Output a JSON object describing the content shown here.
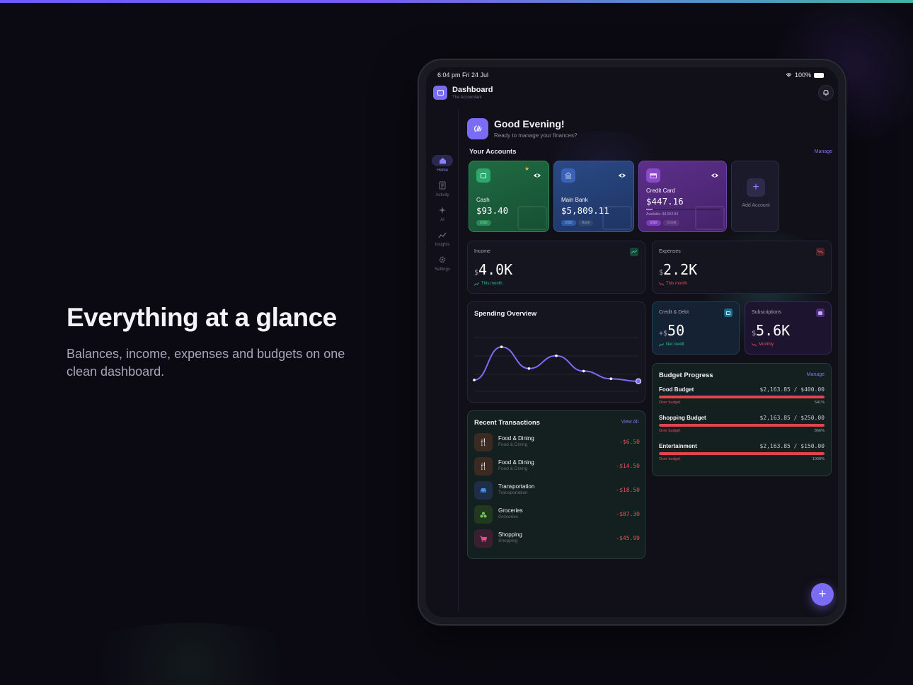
{
  "hero": {
    "title": "Everything at a glance",
    "subtitle": "Balances, income, expenses and budgets on one clean dashboard."
  },
  "status_bar": {
    "time": "6:04 pm  Fri 24 Jul",
    "battery": "100%"
  },
  "header": {
    "title": "Dashboard",
    "subtitle": "The Accountant"
  },
  "nav": [
    {
      "label": "Home",
      "icon": "home-icon",
      "active": true
    },
    {
      "label": "Activity",
      "icon": "activity-icon"
    },
    {
      "label": "AI",
      "icon": "sparkles-icon"
    },
    {
      "label": "Insights",
      "icon": "insights-icon"
    },
    {
      "label": "Settings",
      "icon": "gear-icon"
    }
  ],
  "greeting": {
    "title": "Good Evening!",
    "subtitle": "Ready to manage your finances?"
  },
  "accounts": {
    "title": "Your Accounts",
    "manage": "Manage",
    "items": [
      {
        "name": "Cash",
        "balance": "$93.40",
        "tags": [
          "USD"
        ]
      },
      {
        "name": "Main Bank",
        "balance": "$5,809.11",
        "tags": [
          "USD",
          "Bank"
        ]
      },
      {
        "name": "Credit Card",
        "balance": "$447.16",
        "available": "Available: $4,552.84",
        "tags": [
          "USD",
          "Credit"
        ]
      }
    ],
    "add_label": "Add Account"
  },
  "income": {
    "title": "Income",
    "prefix": "$",
    "value": "4.0K",
    "foot": "This month"
  },
  "expenses": {
    "title": "Expenses",
    "prefix": "$",
    "value": "2.2K",
    "foot": "This month"
  },
  "credit_debt": {
    "title": "Credit & Debt",
    "prefix": "+$",
    "value": "50",
    "foot": "Net credit"
  },
  "subscriptions": {
    "title": "Subscriptions",
    "prefix": "$",
    "value": "5.6K",
    "foot": "Monthly"
  },
  "spending": {
    "title": "Spending Overview",
    "points": [
      0.2,
      0.72,
      0.38,
      0.58,
      0.34,
      0.22,
      0.18
    ]
  },
  "budget": {
    "title": "Budget Progress",
    "manage": "Manage",
    "items": [
      {
        "name": "Food Budget",
        "value": "$2,163.85 / $400.00",
        "status": "Over budget",
        "percent": "541%",
        "fill": 1.0
      },
      {
        "name": "Shopping Budget",
        "value": "$2,163.85 / $250.00",
        "status": "Over budget",
        "percent": "866%",
        "fill": 1.0
      },
      {
        "name": "Entertainment",
        "value": "$2,163.85 / $150.00",
        "status": "Over budget",
        "percent": "1000%",
        "fill": 1.0
      }
    ]
  },
  "transactions": {
    "title": "Recent Transactions",
    "view_all": "View All",
    "items": [
      {
        "name": "Food & Dining",
        "category": "Food & Dining",
        "amount": "-$6.50",
        "icon": "fork-knife-icon"
      },
      {
        "name": "Food & Dining",
        "category": "Food & Dining",
        "amount": "-$14.50",
        "icon": "fork-knife-icon"
      },
      {
        "name": "Transportation",
        "category": "Transportation",
        "amount": "-$18.50",
        "icon": "car-icon"
      },
      {
        "name": "Groceries",
        "category": "Groceries",
        "amount": "-$87.30",
        "icon": "groceries-icon"
      },
      {
        "name": "Shopping",
        "category": "Shopping",
        "amount": "-$45.99",
        "icon": "cart-icon"
      }
    ]
  },
  "colors": {
    "accent": "#7b6cf6",
    "positive": "#2fbf8a",
    "negative": "#e0525a"
  }
}
